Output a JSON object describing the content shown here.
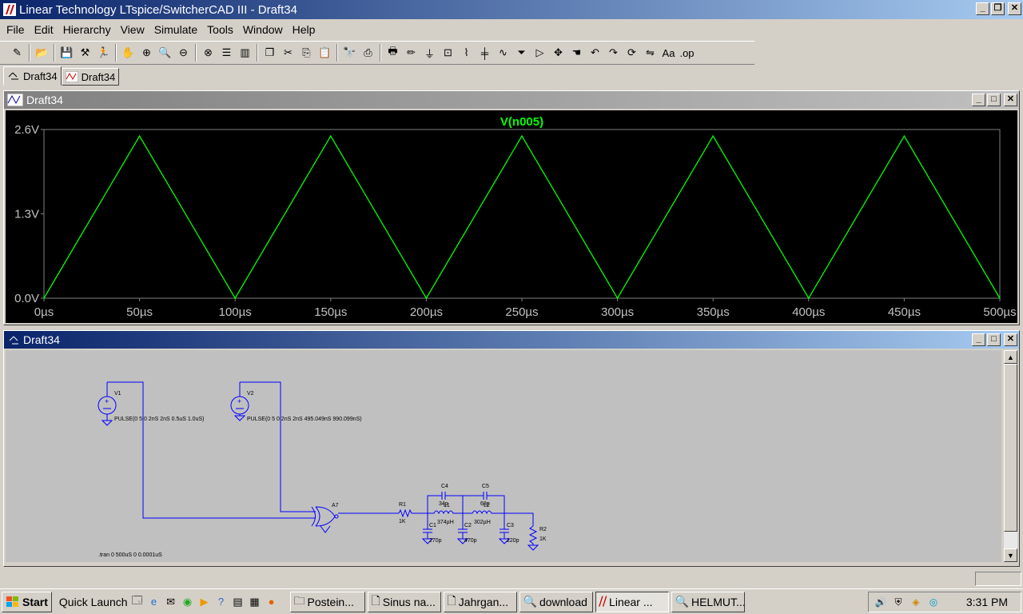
{
  "window": {
    "title": "Linear Technology LTspice/SwitcherCAD III - Draft34"
  },
  "menu": [
    "File",
    "Edit",
    "Hierarchy",
    "View",
    "Simulate",
    "Tools",
    "Window",
    "Help"
  ],
  "toolbar_icons": [
    "new-schematic",
    "open",
    "save",
    "control-panel",
    "run",
    "halt",
    "zoom-in",
    "zoom-pan",
    "zoom-out",
    "zoom-fit",
    "tile-horizontal",
    "tile-vertical",
    "cascade",
    "cut",
    "copy",
    "paste",
    "find",
    "print-preview",
    "print",
    "wire",
    "ground",
    "label",
    "resistor",
    "capacitor",
    "inductor",
    "diode",
    "component",
    "move",
    "drag",
    "undo",
    "redo",
    "rotate",
    "mirror",
    "text",
    "spice-directive"
  ],
  "tabs": [
    {
      "label": "Draft34",
      "icon": "schematic-icon"
    },
    {
      "label": "Draft34",
      "icon": "waveform-icon"
    }
  ],
  "plot_window": {
    "title": "Draft34",
    "trace_label": "V(n005)",
    "trace_color": "#00ff00"
  },
  "chart_data": {
    "type": "line",
    "series": [
      {
        "name": "V(n005)",
        "color": "#00ff00",
        "x": [
          0,
          50,
          100,
          150,
          200,
          250,
          300,
          350,
          400,
          450,
          500
        ],
        "y": [
          0.0,
          2.5,
          0.0,
          2.5,
          0.0,
          2.5,
          0.0,
          2.5,
          0.0,
          2.5,
          0.0
        ]
      }
    ],
    "xlim": [
      0,
      500
    ],
    "ylim": [
      0.0,
      2.6
    ],
    "xticks": [
      "0µs",
      "50µs",
      "100µs",
      "150µs",
      "200µs",
      "250µs",
      "300µs",
      "350µs",
      "400µs",
      "450µs",
      "500µs"
    ],
    "yticks": [
      "0.0V",
      "1.3V",
      "2.6V"
    ],
    "ytick_values": [
      0.0,
      1.3,
      2.6
    ],
    "grid": false,
    "background": "#000000"
  },
  "schematic_window": {
    "title": "Draft34",
    "wire_color": "#0000ff",
    "v1": {
      "name": "V1",
      "value": "PULSE(0 5 0 2nS 2nS 0.5uS 1.0uS)"
    },
    "v2": {
      "name": "V2",
      "value": "PULSE(0 5 0 2nS 2nS 495.049nS 990.099nS)"
    },
    "a7": {
      "name": "A7"
    },
    "r1": {
      "name": "R1",
      "value": "1K"
    },
    "r2": {
      "name": "R2",
      "value": "1K"
    },
    "c1": {
      "name": "C1",
      "value": "270p"
    },
    "c2": {
      "name": "C2",
      "value": "470p"
    },
    "c3": {
      "name": "C3",
      "value": "220p"
    },
    "c4": {
      "name": "C4",
      "value": "34p"
    },
    "c5": {
      "name": "C5",
      "value": "68p"
    },
    "l1": {
      "name": "L1",
      "value": "374µH"
    },
    "l2": {
      "name": "L2",
      "value": "302µH"
    },
    "directive": ".tran 0 500uS 0 0.0001uS"
  },
  "taskbar": {
    "start": "Start",
    "quick_launch": "Quick Launch",
    "buttons": [
      {
        "label": "Postein...",
        "active": false
      },
      {
        "label": "Sinus na...",
        "active": false
      },
      {
        "label": "Jahrgan...",
        "active": false
      },
      {
        "label": "download",
        "active": false
      },
      {
        "label": "Linear ...",
        "active": true
      },
      {
        "label": "HELMUT...",
        "active": false
      }
    ],
    "clock": "3:31 PM"
  }
}
